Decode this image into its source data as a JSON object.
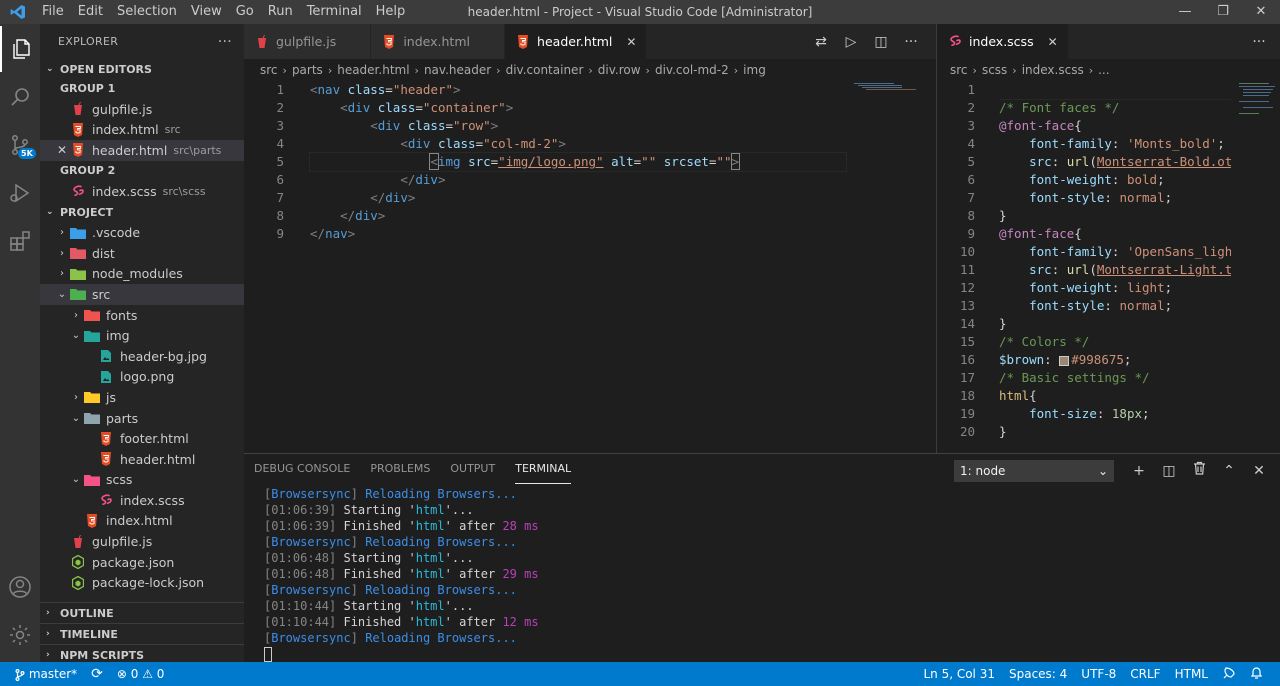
{
  "window": {
    "title": "header.html - Project - Visual Studio Code [Administrator]",
    "menu": [
      "File",
      "Edit",
      "Selection",
      "View",
      "Go",
      "Run",
      "Terminal",
      "Help"
    ],
    "controls": [
      "—",
      "❐",
      "✕"
    ]
  },
  "activity": {
    "badge": "5K",
    "icons": [
      "explorer-icon",
      "search-icon",
      "source-control-icon",
      "run-debug-icon",
      "extensions-icon",
      "account-icon",
      "settings-gear-icon"
    ]
  },
  "sidebar": {
    "title": "EXPLORER",
    "more": "···",
    "open_editors_label": "OPEN EDITORS",
    "group1_label": "GROUP 1",
    "group2_label": "GROUP 2",
    "open_editors_g1": [
      {
        "name": "gulpfile.js",
        "path": "",
        "icon": "gulp-icon",
        "color": "#e0414b"
      },
      {
        "name": "index.html",
        "path": "src",
        "icon": "html-icon",
        "color": "#e44d26"
      },
      {
        "name": "header.html",
        "path": "src\\parts",
        "icon": "html-icon",
        "color": "#e44d26",
        "selected": true
      }
    ],
    "open_editors_g2": [
      {
        "name": "index.scss",
        "path": "src\\scss",
        "icon": "sass-icon",
        "color": "#f55385"
      }
    ],
    "project_label": "PROJECT",
    "tree": [
      {
        "name": ".vscode",
        "type": "folder",
        "color": "#3b9ee8",
        "indent": 0,
        "chev": "›"
      },
      {
        "name": "dist",
        "type": "folder",
        "color": "#e35a65",
        "indent": 0,
        "chev": "›"
      },
      {
        "name": "node_modules",
        "type": "folder",
        "color": "#8bc34a",
        "indent": 0,
        "chev": "›"
      },
      {
        "name": "src",
        "type": "folder",
        "color": "#4caf50",
        "indent": 0,
        "chev": "⌄",
        "selected": true
      },
      {
        "name": "fonts",
        "type": "folder",
        "color": "#ef5350",
        "indent": 1,
        "chev": "›"
      },
      {
        "name": "img",
        "type": "folder",
        "color": "#26a69a",
        "indent": 1,
        "chev": "⌄"
      },
      {
        "name": "header-bg.jpg",
        "type": "image",
        "color": "#26a69a",
        "indent": 2
      },
      {
        "name": "logo.png",
        "type": "image",
        "color": "#26a69a",
        "indent": 2
      },
      {
        "name": "js",
        "type": "folder",
        "color": "#ffca28",
        "indent": 1,
        "chev": "›"
      },
      {
        "name": "parts",
        "type": "folder",
        "color": "#90a4ae",
        "indent": 1,
        "chev": "⌄"
      },
      {
        "name": "footer.html",
        "type": "html",
        "color": "#e44d26",
        "indent": 2
      },
      {
        "name": "header.html",
        "type": "html",
        "color": "#e44d26",
        "indent": 2
      },
      {
        "name": "scss",
        "type": "folder",
        "color": "#f55385",
        "indent": 1,
        "chev": "⌄"
      },
      {
        "name": "index.scss",
        "type": "sass",
        "color": "#f55385",
        "indent": 2
      },
      {
        "name": "index.html",
        "type": "html",
        "color": "#e44d26",
        "indent": 1
      },
      {
        "name": "gulpfile.js",
        "type": "gulp",
        "color": "#e0414b",
        "indent": 0
      },
      {
        "name": "package.json",
        "type": "node",
        "color": "#8bc34a",
        "indent": 0
      },
      {
        "name": "package-lock.json",
        "type": "node",
        "color": "#8bc34a",
        "indent": 0
      }
    ],
    "bottom_sections": [
      "OUTLINE",
      "TIMELINE",
      "NPM SCRIPTS"
    ]
  },
  "editor1": {
    "tabs": [
      {
        "label": "gulpfile.js",
        "icon": "gulp-icon",
        "color": "#e0414b",
        "active": false
      },
      {
        "label": "index.html",
        "icon": "html-icon",
        "color": "#e44d26",
        "active": false
      },
      {
        "label": "header.html",
        "icon": "html-icon",
        "color": "#e44d26",
        "active": true,
        "close": "✕"
      }
    ],
    "actions": [
      "⇄",
      "▷",
      "◫",
      "···"
    ],
    "breadcrumb": [
      "src",
      "parts",
      "header.html",
      "nav.header",
      "div.container",
      "div.row",
      "div.col-md-2",
      "img"
    ],
    "line_numbers": [
      "1",
      "2",
      "3",
      "4",
      "5",
      "6",
      "7",
      "8",
      "9"
    ]
  },
  "editor2": {
    "tabs": [
      {
        "label": "index.scss",
        "icon": "sass-icon",
        "color": "#f55385",
        "active": true,
        "close": "✕"
      }
    ],
    "more": "···",
    "breadcrumb": [
      "src",
      "scss",
      "index.scss",
      "..."
    ],
    "line_numbers": [
      "1",
      "2",
      "3",
      "4",
      "5",
      "6",
      "7",
      "8",
      "9",
      "10",
      "11",
      "12",
      "13",
      "14",
      "15",
      "16",
      "17",
      "18",
      "19",
      "20"
    ]
  },
  "panel": {
    "tabs": [
      "DEBUG CONSOLE",
      "PROBLEMS",
      "OUTPUT",
      "TERMINAL"
    ],
    "active_tab": "TERMINAL",
    "terminal_select": "1: node",
    "actions": [
      "+",
      "◫",
      "🗑",
      "⌃",
      "✕"
    ]
  },
  "statusbar": {
    "branch": "master*",
    "sync": "⟳",
    "problems": "⊗ 0 ⚠ 0",
    "position": "Ln 5, Col 31",
    "spaces": "Spaces: 4",
    "encoding": "UTF-8",
    "eol": "CRLF",
    "language": "HTML"
  }
}
